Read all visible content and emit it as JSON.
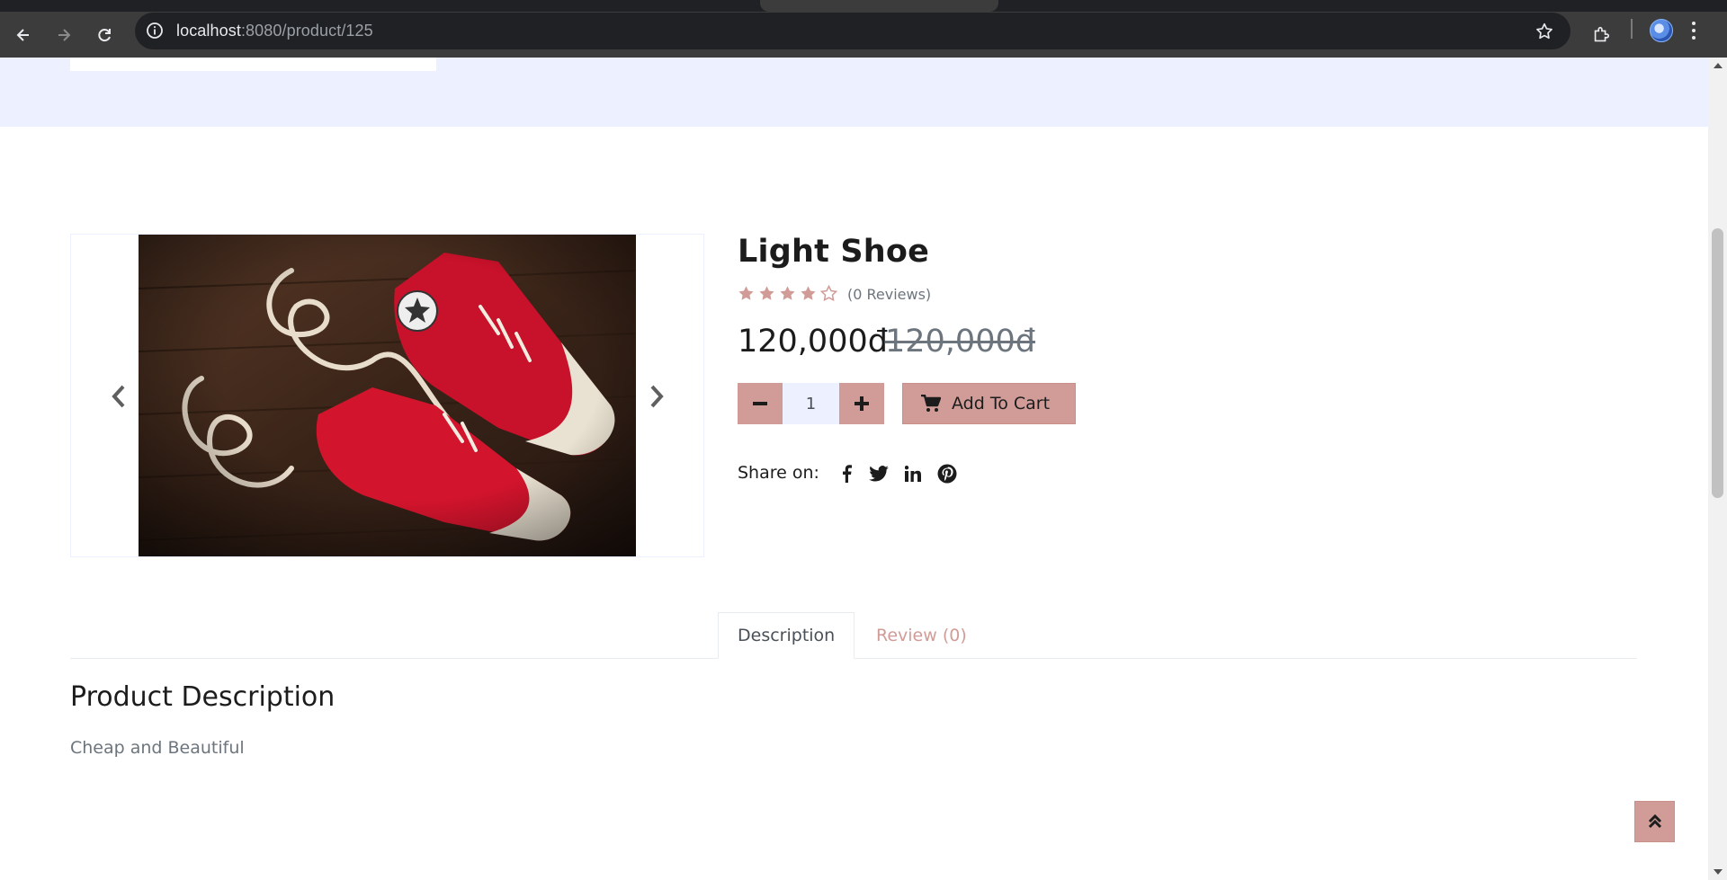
{
  "browser": {
    "url_host": "localhost",
    "url_path": ":8080/product/125"
  },
  "product": {
    "title": "Light Shoe",
    "rating": 4,
    "rating_max": 5,
    "reviews_label": "(0 Reviews)",
    "price": "120,000đ",
    "old_price": "120,000đ",
    "quantity": "1",
    "add_to_cart_label": "Add To Cart",
    "share_label": "Share on:",
    "share_icons": [
      "facebook-icon",
      "twitter-icon",
      "linkedin-icon",
      "pinterest-icon"
    ]
  },
  "tabs": [
    {
      "label": "Description",
      "active": true
    },
    {
      "label": "Review (0)",
      "active": false
    }
  ],
  "description": {
    "heading": "Product Description",
    "text": "Cheap and Beautiful"
  },
  "colors": {
    "accent": "#d19c97",
    "light_band": "#edf1ff",
    "text_dark": "#1c1c1c",
    "text_muted": "#6c757d"
  }
}
